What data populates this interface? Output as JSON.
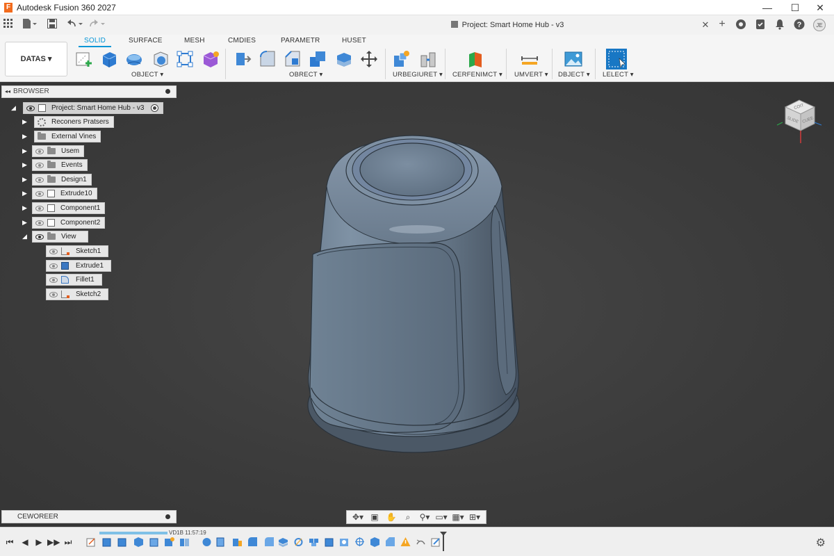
{
  "app": {
    "logo_letter": "F",
    "window_title": "Autodesk Fusion 360 2027",
    "window_controls": [
      "—",
      "☐",
      "✕"
    ]
  },
  "document": {
    "tab_title": "Project: Smart Home Hub - v3"
  },
  "quick_access": {
    "grid_icon": "apps-grid-icon",
    "file_icon": "file-icon",
    "save_icon": "save-icon",
    "undo_icon": "undo-icon",
    "redo_icon": "redo-icon"
  },
  "ribbon": {
    "workspace_button": "DATAS ▾",
    "tabs": [
      {
        "label": "SOLID",
        "active": true
      },
      {
        "label": "SURFACE",
        "active": false
      },
      {
        "label": "MESH",
        "active": false
      },
      {
        "label": "CMDIES",
        "active": false
      },
      {
        "label": "PARAMETR",
        "active": false
      },
      {
        "label": "HUSET",
        "active": false
      }
    ],
    "groups": [
      {
        "label": "OBJECT ▾"
      },
      {
        "label": "OBRECT ▾"
      },
      {
        "label": "URBEGIURET ▾"
      },
      {
        "label": "CERFENIMCT ▾"
      },
      {
        "label": "UMVERT ▾"
      },
      {
        "label": "DBJECT ▾"
      },
      {
        "label": "LELECT ▾"
      }
    ]
  },
  "browser": {
    "header": "BROWSER",
    "collapse_glyph": "◂◂",
    "root": "Project: Smart Home Hub - v3",
    "items": [
      {
        "label": "Reconers Pratsers",
        "icon": "gear"
      },
      {
        "label": "External Vines",
        "icon": "folder"
      },
      {
        "label": "Usem",
        "icon": "folder"
      },
      {
        "label": "Events",
        "icon": "folder"
      },
      {
        "label": "Design1",
        "icon": "folder"
      },
      {
        "label": "Extrude10",
        "icon": "component"
      },
      {
        "label": "Component1",
        "icon": "component"
      },
      {
        "label": "Component2",
        "icon": "component"
      },
      {
        "label": "View",
        "icon": "folder",
        "expanded": true
      }
    ],
    "children": [
      {
        "label": "Sketch1",
        "icon": "sketch"
      },
      {
        "label": "Extrude1",
        "icon": "extrude"
      },
      {
        "label": "Fillet1",
        "icon": "fillet"
      },
      {
        "label": "Sketch2",
        "icon": "sketch"
      }
    ]
  },
  "comments": {
    "label": "CEWOREER"
  },
  "viewcube": {
    "top": "COIT",
    "front": "SLIDE",
    "right": "CUEE"
  },
  "timeline": {
    "timestamp": "VD1B 11:57:19",
    "controls": [
      "⏮",
      "◀",
      "▶",
      "▶▶",
      "⏭"
    ]
  }
}
